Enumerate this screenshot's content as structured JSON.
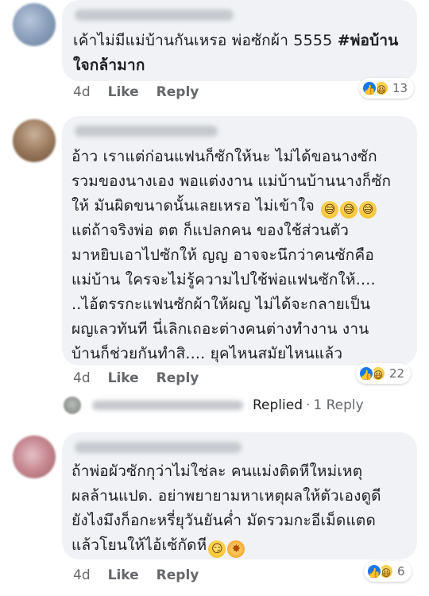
{
  "comments": [
    {
      "lines": [
        "เค้าไม่มีแม่บ้านกันเหรอ พ่อซักผ้า 5555 ",
        "ใจกล้ามาก"
      ],
      "hashtag": "#พ่อบ้าน",
      "time": "4d",
      "like_label": "Like",
      "reply_label": "Reply",
      "reaction_count": "13"
    },
    {
      "lines": [
        "อ้าว เราแต่ก่อนแฟนก็ซักให้นะ ไม่ได้ขอนางซัก",
        "รวมของนางเอง พอแต่งงาน แม่บ้านบ้านนางก็ซัก",
        "ให้ มันผิดขนาดนั้นเลยเหรอ ไม่เข้าใจ",
        "แต่ถ้าจริงพ่อ ตต ก็แปลกคน ของใช้ส่วนตัว",
        "มาหยิบเอาไปซักให้ ญญ อาจจะนึกว่าคนซักคือ",
        "แม่บ้าน ใครจะไม่รู้ความไปใช้พ่อแฟนซักให้....",
        "..ไอ้ตรรกะแฟนซักผ้าให้ผญ ไม่ได้จะกลายเป็น",
        "ผญเลวทันที นี่เลิกเถอะต่างคนต่างทำงาน งาน",
        "บ้านก็ช่วยกันทำสิ.... ยุคไหนสมัยไหนแล้ว"
      ],
      "time": "4d",
      "like_label": "Like",
      "reply_label": "Reply",
      "reaction_count": "22"
    },
    {
      "lines": [
        "ถ้าพ่อผัวซักกุว่าไม่ใช่ละ คนแม่งติดหีใหม่เหตุ",
        "ผลล้านแปด. อย่าพยายามหาเหตุผลให้ตัวเองดูดี",
        "ยังไงมึงก็อกะหรี่ยุวันยันค่ำ มัดรวมกะอีเม็ดแตด",
        "แล้วโยนให้ไอ้เซ้กัดหี"
      ],
      "time": "4d",
      "like_label": "Like",
      "reply_label": "Reply",
      "reaction_count": "6"
    }
  ],
  "replied": {
    "label": "Replied",
    "separator": "·",
    "count_label": "1 Reply"
  },
  "icons": {
    "like_reaction": "thumbs-up-icon",
    "haha_reaction": "laughing-face-icon",
    "emoji_laugh": "grinning-sweat-icon",
    "emoji_smirk": "smirk-face-icon",
    "emoji_star": "sparkle-icon"
  },
  "colors": {
    "bubble": "#f0f2f5",
    "meta_text": "#65676b",
    "like_blue": "#1877f2"
  }
}
